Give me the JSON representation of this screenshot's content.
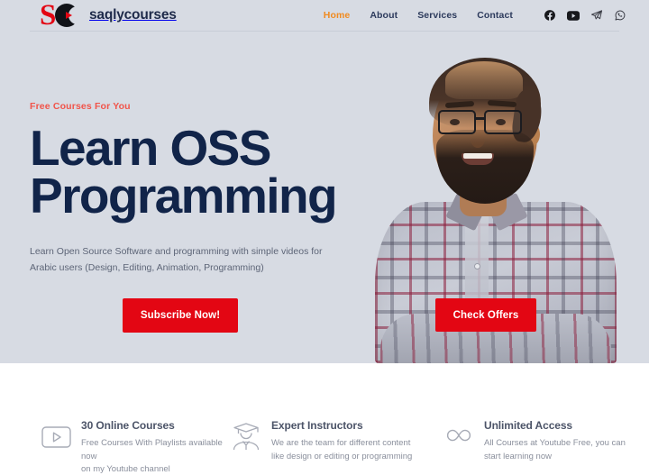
{
  "brand": {
    "name": "saqlycourses",
    "logo_icon": "sc-monogram-play-icon",
    "logo_letter_s": "S",
    "logo_color_red": "#e30613",
    "logo_color_dark": "#111318"
  },
  "nav": {
    "items": [
      {
        "label": "Home",
        "active": true
      },
      {
        "label": "About",
        "active": false
      },
      {
        "label": "Services",
        "active": false
      },
      {
        "label": "Contact",
        "active": false
      }
    ],
    "active_color": "#f08b21",
    "link_color": "#2c3a5c",
    "social": [
      {
        "name": "facebook-icon",
        "label": "Facebook"
      },
      {
        "name": "youtube-icon",
        "label": "YouTube"
      },
      {
        "name": "telegram-icon",
        "label": "Telegram"
      },
      {
        "name": "whatsapp-icon",
        "label": "WhatsApp"
      }
    ]
  },
  "hero": {
    "eyebrow": "Free Courses For You",
    "eyebrow_color": "#f1544a",
    "title": "Learn OSS\nProgramming",
    "title_color": "#112449",
    "subtitle": "Learn Open Source Software and programming with simple videos for\nArabic users (Design, Editing, Animation, Programming)",
    "background_color": "#d7dbe3",
    "primary_button": "Subscribe Now!",
    "secondary_button": "Check Offers",
    "button_color": "#e30613",
    "photo_alt": "Smiling man with glasses and beard wearing a plaid shirt, arms crossed"
  },
  "features": [
    {
      "icon": "play-box-icon",
      "title": "30 Online Courses",
      "desc": "Free Courses With Playlists available now\non my Youtube channel"
    },
    {
      "icon": "graduate-instructor-icon",
      "title": "Expert Instructors",
      "desc": "We are the team for different content\nlike design or editing or programming"
    },
    {
      "icon": "infinity-icon",
      "title": "Unlimited Access",
      "desc": "All Courses at Youtube Free, you can\nstart learning now"
    }
  ]
}
